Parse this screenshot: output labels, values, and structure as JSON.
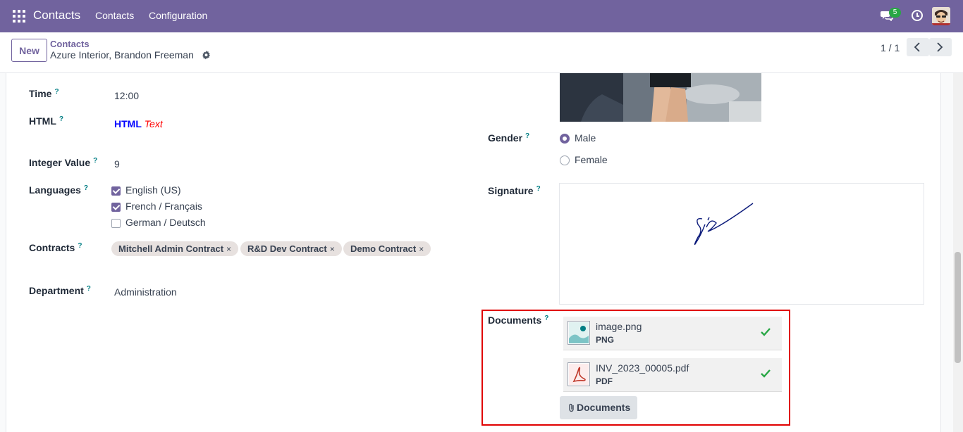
{
  "topbar": {
    "app_title": "Contacts",
    "menu": [
      "Contacts",
      "Configuration"
    ],
    "chat_count": "5"
  },
  "control": {
    "new_label": "New",
    "breadcrumb_parent": "Contacts",
    "breadcrumb_current": "Azure Interior, Brandon Freeman",
    "pager": "1 / 1"
  },
  "form": {
    "help_mark": "?",
    "time": {
      "label": "Time",
      "value": "12:00"
    },
    "html": {
      "label": "HTML",
      "value_a": "HTML",
      "value_b": "Text"
    },
    "integer": {
      "label": "Integer Value",
      "value": "9"
    },
    "languages": {
      "label": "Languages",
      "options": [
        {
          "label": "English (US)",
          "checked": true
        },
        {
          "label": "French / Français",
          "checked": true
        },
        {
          "label": "German / Deutsch",
          "checked": false
        }
      ]
    },
    "contracts": {
      "label": "Contracts",
      "tags": [
        "Mitchell Admin Contract",
        "R&D Dev Contract",
        "Demo Contract"
      ],
      "remove_glyph": "×"
    },
    "department": {
      "label": "Department",
      "value": "Administration"
    },
    "gender": {
      "label": "Gender",
      "options": [
        {
          "label": "Male",
          "selected": true
        },
        {
          "label": "Female",
          "selected": false
        }
      ]
    },
    "signature": {
      "label": "Signature"
    },
    "documents": {
      "label": "Documents",
      "files": [
        {
          "name": "image.png",
          "type": "PNG",
          "icon": "image-file-icon"
        },
        {
          "name": "INV_2023_00005.pdf",
          "type": "PDF",
          "icon": "pdf-file-icon"
        }
      ],
      "button_label": "Documents"
    }
  },
  "colors": {
    "brand": "#71639e",
    "success": "#28a745",
    "highlight": "#e00000"
  }
}
